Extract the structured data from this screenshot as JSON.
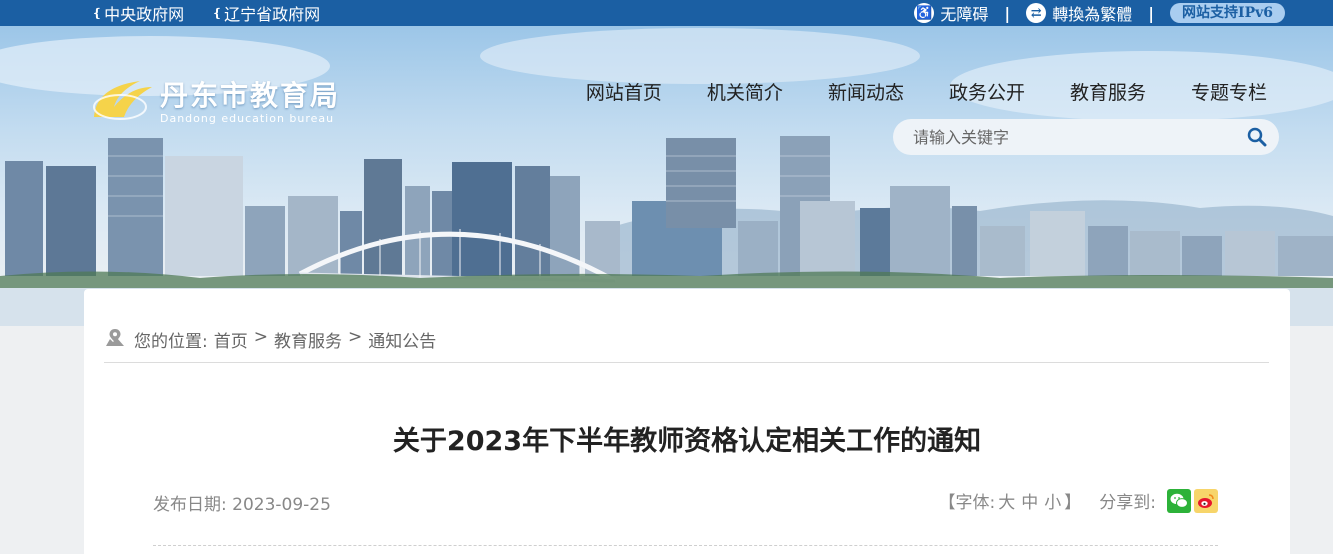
{
  "topbar": {
    "links": [
      {
        "label": "中央政府网"
      },
      {
        "label": "辽宁省政府网"
      }
    ],
    "accessibility": "无障碍",
    "convert": "轉換為繁體",
    "divider": "|",
    "ipv6": "网站支持IPv6"
  },
  "brand": {
    "name_cn": "丹东市教育局",
    "name_en": "Dandong education bureau",
    "accent": "#f5d34a"
  },
  "nav": {
    "items": [
      {
        "label": "网站首页"
      },
      {
        "label": "机关简介"
      },
      {
        "label": "新闻动态"
      },
      {
        "label": "政务公开"
      },
      {
        "label": "教育服务"
      },
      {
        "label": "专题专栏"
      }
    ]
  },
  "search": {
    "placeholder": "请输入关键字",
    "icon": "search-icon"
  },
  "breadcrumb": {
    "prefix": "您的位置:",
    "items": [
      "首页",
      "教育服务",
      "通知公告"
    ],
    "separator": ">"
  },
  "article": {
    "title": "关于2023年下半年教师资格认定相关工作的通知",
    "date_label": "发布日期:",
    "date": "2023-09-25",
    "font_label": "【字体:",
    "font_sizes": [
      "大",
      "中",
      "小"
    ],
    "font_close": "】",
    "share_label": "分享到:"
  },
  "colors": {
    "topbar": "#1b5fa3",
    "ipv6_badge": "#a9cdf0",
    "wechat": "#2db239",
    "weibo": "#f7d56a"
  }
}
